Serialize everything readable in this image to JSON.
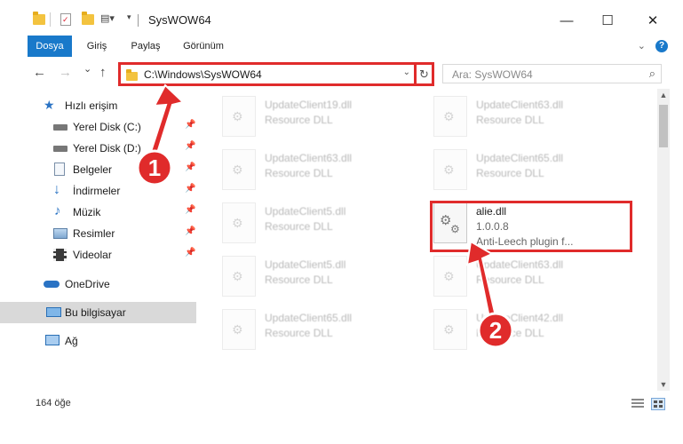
{
  "window": {
    "title": "SysWOW64",
    "minimize_glyph": "—",
    "maximize_glyph": "☐",
    "close_glyph": "✕"
  },
  "ribbon": {
    "tabs": [
      "Dosya",
      "Giriş",
      "Paylaş",
      "Görünüm"
    ],
    "collapse_glyph": "⌄",
    "help_glyph": "?"
  },
  "address": {
    "path": "C:\\Windows\\SysWOW64",
    "back_glyph": "←",
    "forward_glyph": "→",
    "recent_glyph": "⌄",
    "up_glyph": "↑",
    "dropdown_glyph": "⌄",
    "refresh_glyph": "↻"
  },
  "search": {
    "placeholder": "Ara: SysWOW64",
    "icon_glyph": "⌕"
  },
  "nav": {
    "items": [
      {
        "label": "Hızlı erişim",
        "icon": "star-icon"
      },
      {
        "label": "Yerel Disk (C:)",
        "icon": "drive-icon",
        "pinned": true
      },
      {
        "label": "Yerel Disk (D:)",
        "icon": "drive-icon",
        "pinned": true
      },
      {
        "label": "Belgeler",
        "icon": "document-icon",
        "pinned": true
      },
      {
        "label": "İndirmeler",
        "icon": "download-icon",
        "pinned": true
      },
      {
        "label": "Müzik",
        "icon": "music-icon",
        "pinned": true
      },
      {
        "label": "Resimler",
        "icon": "picture-icon",
        "pinned": true
      },
      {
        "label": "Videolar",
        "icon": "video-icon",
        "pinned": true
      },
      {
        "label": "OneDrive",
        "icon": "cloud-icon"
      },
      {
        "label": "Bu bilgisayar",
        "icon": "computer-icon",
        "selected": true
      },
      {
        "label": "Ağ",
        "icon": "network-icon"
      }
    ],
    "pin_glyph": "📌"
  },
  "files": [
    {
      "name": "UpdateClient19.dll",
      "desc": "Resource DLL",
      "faded": true
    },
    {
      "name": "UpdateClient63.dll",
      "desc": "Resource DLL",
      "faded": true
    },
    {
      "name": "UpdateClient63.dll",
      "desc": "Resource DLL",
      "faded": true
    },
    {
      "name": "UpdateClient65.dll",
      "desc": "Resource DLL",
      "faded": true
    },
    {
      "name": "UpdateClient5.dll",
      "desc": "Resource DLL",
      "faded": true
    },
    {
      "name": "alie.dll",
      "version": "1.0.0.8",
      "desc": "Anti-Leech plugin f...",
      "faded": false
    },
    {
      "name": "UpdateClient5.dll",
      "desc": "Resource DLL",
      "faded": true
    },
    {
      "name": "UpdateClient63.dll",
      "desc": "Resource DLL",
      "faded": true
    },
    {
      "name": "UpdateClient65.dll",
      "desc": "Resource DLL",
      "faded": true
    },
    {
      "name": "UpdateClient42.dll",
      "desc": "Resource DLL",
      "faded": true
    }
  ],
  "status": {
    "item_count": "164 öğe"
  },
  "annotations": {
    "step1": "1",
    "step2": "2",
    "color": "#e02b2b"
  }
}
